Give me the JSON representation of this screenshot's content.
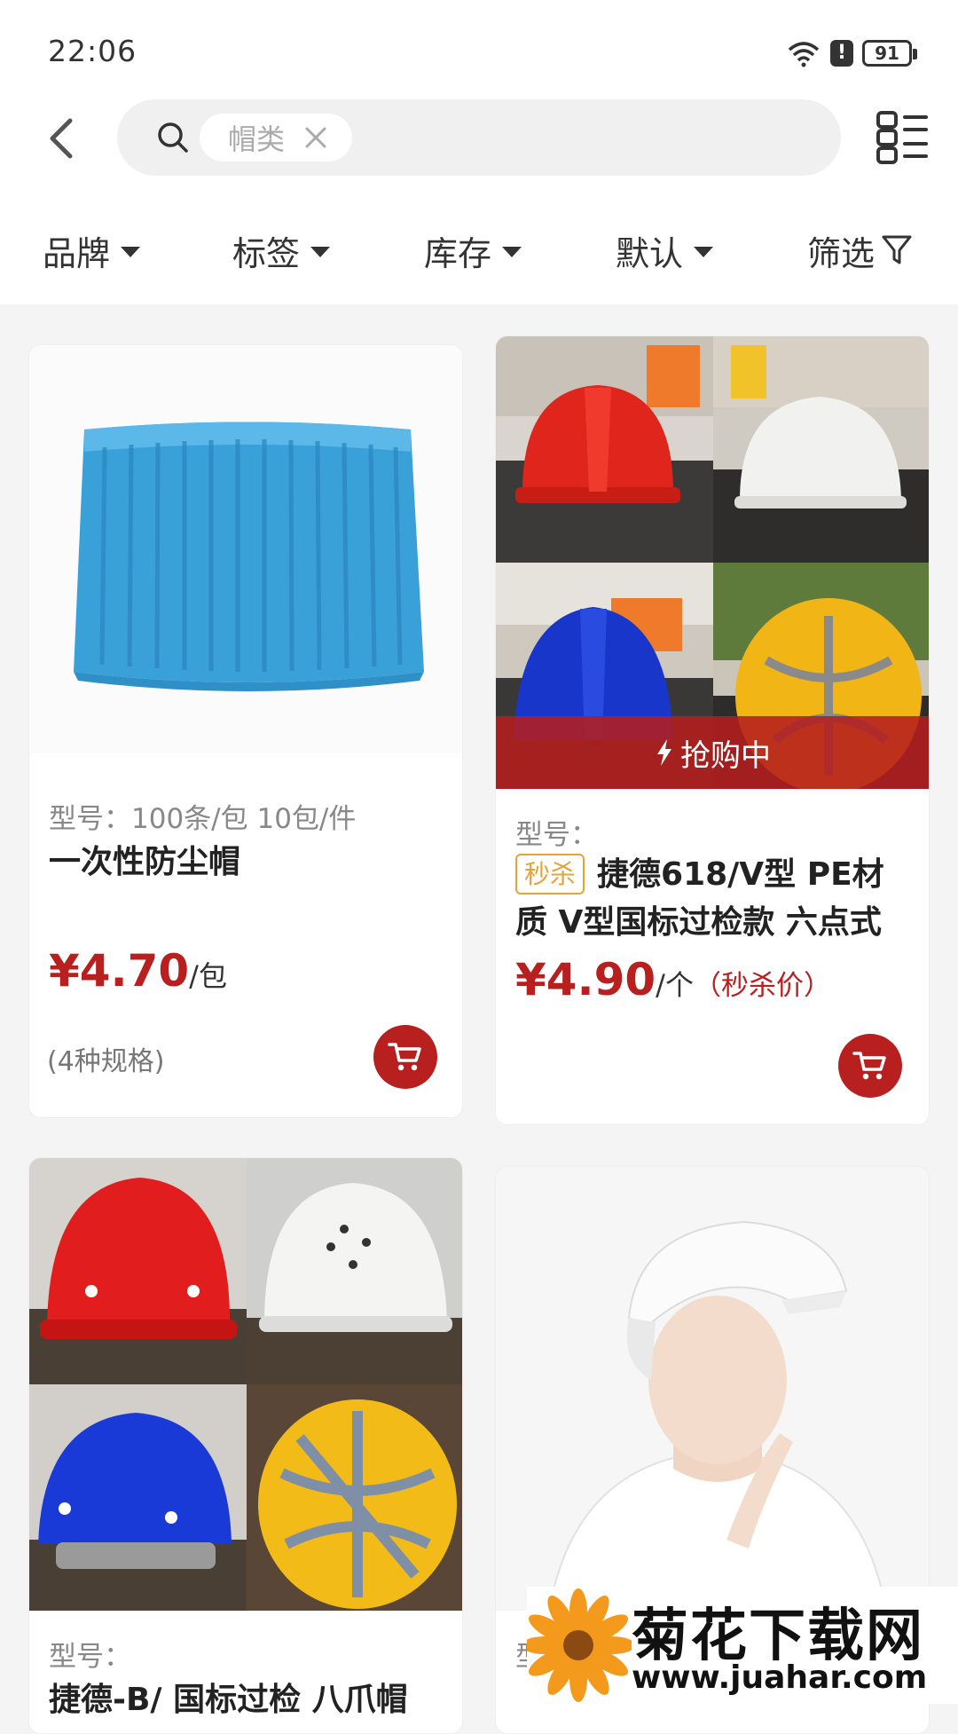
{
  "status_bar": {
    "time": "22:06",
    "battery": "91"
  },
  "search": {
    "chip_label": "帽类"
  },
  "filters": [
    {
      "label": "品牌"
    },
    {
      "label": "标签"
    },
    {
      "label": "库存"
    },
    {
      "label": "默认"
    },
    {
      "label": "筛选"
    }
  ],
  "products": [
    {
      "model": "型号：100条/包 10包/件",
      "name": "一次性防尘帽",
      "price": "¥4.70",
      "unit": "/包",
      "specs": "(4种规格)",
      "image": "blue-disposable-cap-pack"
    },
    {
      "model": "型号：",
      "badge": "秒杀",
      "name_line1": "捷德618/V型 PE材",
      "name_line2": "质 V型国标过检款 六点式",
      "price": "¥4.90",
      "unit": "/个",
      "price_note": "（秒杀价）",
      "banner": "抢购中",
      "image": "v-type-safety-helmets"
    },
    {
      "model": "型号：",
      "name": "捷德-B/ 国标过检 八爪帽",
      "image": "round-safety-helmets"
    },
    {
      "model": "型",
      "image": "white-food-hygiene-cap-model"
    }
  ],
  "watermark": {
    "title": "菊花下载网",
    "url": "www.juahar.com"
  },
  "colors": {
    "accent": "#b81f1f",
    "badge": "#e6a437",
    "background": "#f4f4f4"
  }
}
